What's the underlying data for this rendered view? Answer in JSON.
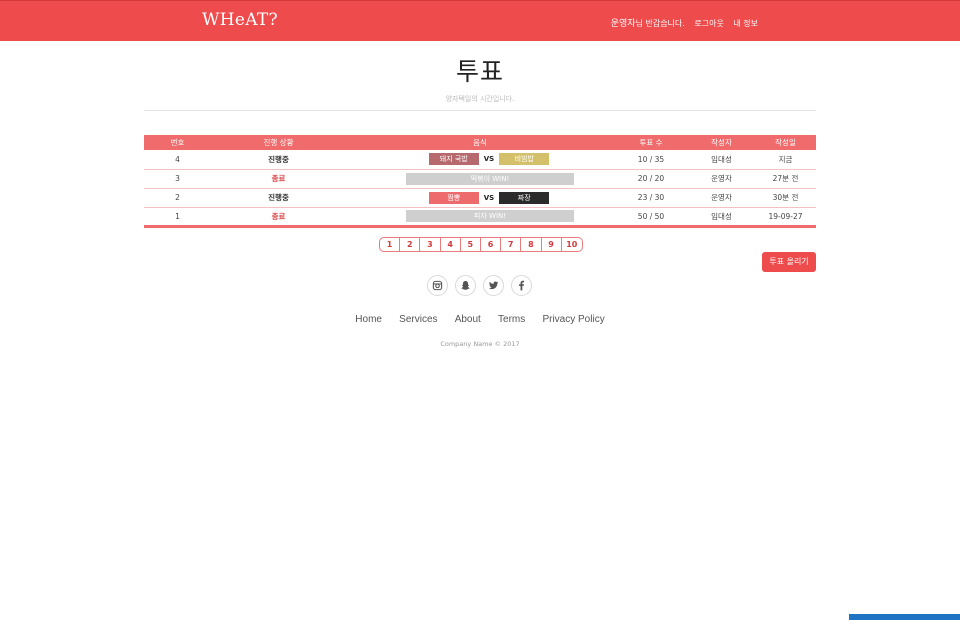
{
  "navbar": {
    "brand": "WHeAT?",
    "user_name": "운영자",
    "greeting": "님 반갑습니다.",
    "logout": "로그아웃",
    "my_info": "내 정보"
  },
  "hero": {
    "title": "투표",
    "subtitle": "양자택일의 시간입니다."
  },
  "table": {
    "headers": [
      "번호",
      "진행 상황",
      "음식",
      "투표 수",
      "작성자",
      "작성일"
    ],
    "rows": [
      {
        "num": "4",
        "status": "진행중",
        "left": "돼지 국밥",
        "vs": "VS",
        "right": "비빔밥",
        "votes": "10 / 35",
        "author": "임대성",
        "date": "지금"
      },
      {
        "num": "3",
        "status": "종료",
        "winner": "떡볶이 WIN!",
        "votes": "20 / 20",
        "author": "운영자",
        "date": "27분 전"
      },
      {
        "num": "2",
        "status": "진행중",
        "left": "짬뽕",
        "vs": "VS",
        "right": "짜장",
        "votes": "23 / 30",
        "author": "운영자",
        "date": "30분 전"
      },
      {
        "num": "1",
        "status": "종료",
        "winner": "피자 WIN!",
        "votes": "50 / 50",
        "author": "임대성",
        "date": "19-09-27"
      }
    ]
  },
  "pagination": [
    "1",
    "2",
    "3",
    "4",
    "5",
    "6",
    "7",
    "8",
    "9",
    "10"
  ],
  "post_button": "투표 올리기",
  "social": [
    "instagram-icon",
    "snapchat-icon",
    "twitter-icon",
    "facebook-icon"
  ],
  "footer": {
    "links": [
      "Home",
      "Services",
      "About",
      "Terms",
      "Privacy Policy"
    ],
    "copyright": "Company Name © 2017"
  },
  "colors": {
    "primary": "#ee4b4d",
    "table_header": "#ef6b6c",
    "chip_gukbap": "#b76a6e",
    "chip_bibimbap": "#d4c06a",
    "chip_jjamppong": "#ee6b6d",
    "chip_jjajang": "#2b2b2b",
    "winner_bar": "#cfcfcf"
  }
}
